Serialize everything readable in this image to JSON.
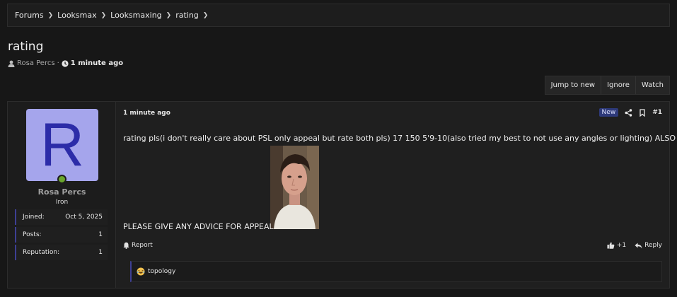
{
  "breadcrumb": [
    "Forums",
    "Looksmax",
    "Looksmaxing",
    "rating"
  ],
  "thread": {
    "title": "rating",
    "author": "Rosa Percs",
    "separator": "·",
    "time": "1 minute ago"
  },
  "toolbar": {
    "jump_label": "Jump to new",
    "ignore_label": "Ignore",
    "watch_label": "Watch"
  },
  "user": {
    "avatar_letter": "R",
    "name": "Rosa Percs",
    "rank": "Iron",
    "stats": [
      {
        "label": "Joined:",
        "value": "Oct 5, 2025"
      },
      {
        "label": "Posts:",
        "value": "1"
      },
      {
        "label": "Reputation:",
        "value": "1"
      }
    ]
  },
  "post": {
    "time": "1 minute ago",
    "badge": "New",
    "number": "#1",
    "body": "rating pls(i don't really care about PSL only appeal but rate both pls) 17 150 5'9-10(also tried my best to not use any angles or lighting) ALSO",
    "advice": "PLEASE GIVE ANY ADVICE FOR APPEAL",
    "report_label": "Report",
    "like_count": "+1",
    "reply_label": "Reply"
  },
  "reactions": {
    "user": "topology"
  },
  "icons": [
    "user-icon",
    "clock-icon",
    "share-icon",
    "bookmark-icon",
    "bell-icon",
    "thumbs-up-icon",
    "reply-icon",
    "laugh-emoji-icon",
    "chevron-right-icon"
  ],
  "colors": {
    "background": "#171717",
    "panel": "#1f1f1f",
    "accent": "#3d3f94",
    "avatar_bg": "#a5a5ec",
    "avatar_fg": "#2c2ca8",
    "online": "#6aa62c",
    "badge_bg": "#2e3a7a"
  }
}
